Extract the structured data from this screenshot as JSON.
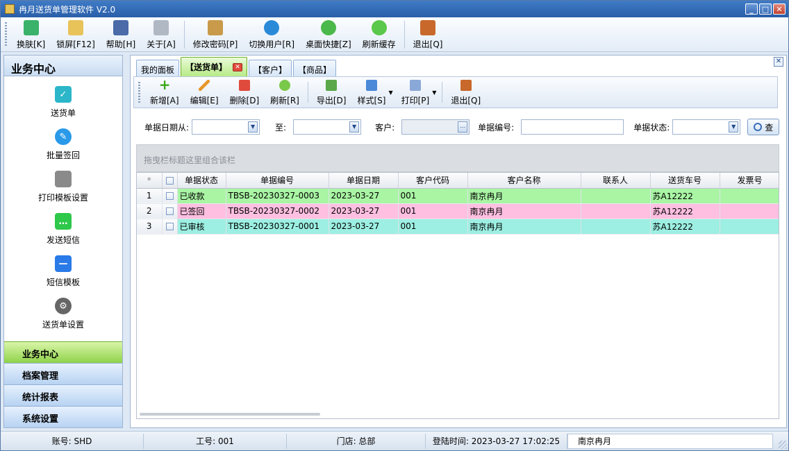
{
  "window": {
    "title": "冉月送货单管理软件 V2.0"
  },
  "main_toolbar": [
    {
      "label": "换肤[K]",
      "icon": "shirt-icon",
      "color": "#3ab26a"
    },
    {
      "label": "锁屏[F12]",
      "icon": "lock-icon",
      "color": "#e8c35a"
    },
    {
      "label": "帮助[H]",
      "icon": "help-book-icon",
      "color": "#4a6aa8"
    },
    {
      "label": "关于[A]",
      "icon": "about-icon",
      "color": "#b0b8c4"
    },
    {
      "label": "修改密码[P]",
      "icon": "key-icon",
      "color": "#c89a4a"
    },
    {
      "label": "切换用户[R]",
      "icon": "switch-user-icon",
      "color": "#2a8ad8"
    },
    {
      "label": "桌面快捷[Z]",
      "icon": "desktop-shortcut-icon",
      "color": "#4ab84a"
    },
    {
      "label": "刷新缓存",
      "icon": "refresh-cache-icon",
      "color": "#5ac84a"
    },
    {
      "label": "退出[Q]",
      "icon": "exit-door-icon",
      "color": "#c8682a"
    }
  ],
  "left_panel": {
    "title": "业务中心",
    "items": [
      {
        "label": "送货单",
        "icon": "delivery-note-icon",
        "color": "#2bb6c9"
      },
      {
        "label": "批量签回",
        "icon": "batch-sign-icon",
        "color": "#2a9ae8"
      },
      {
        "label": "打印模板设置",
        "icon": "printer-icon",
        "color": "#8a8a8a"
      },
      {
        "label": "发送短信",
        "icon": "sms-send-icon",
        "color": "#2ec84a"
      },
      {
        "label": "短信模板",
        "icon": "sms-template-icon",
        "color": "#2a7ae8"
      },
      {
        "label": "送货单设置",
        "icon": "gear-icon",
        "color": "#666666"
      }
    ],
    "groups": [
      {
        "label": "业务中心",
        "active": true
      },
      {
        "label": "档案管理",
        "active": false
      },
      {
        "label": "统计报表",
        "active": false
      },
      {
        "label": "系统设置",
        "active": false
      }
    ]
  },
  "tabs": [
    {
      "label": "我的面板"
    },
    {
      "label": "【送货单】"
    },
    {
      "label": "【客户】"
    },
    {
      "label": "【商品】"
    }
  ],
  "sub_toolbar": [
    {
      "label": "新增[A]",
      "icon": "add-icon"
    },
    {
      "label": "编辑[E]",
      "icon": "edit-pencil-icon"
    },
    {
      "label": "删除[D]",
      "icon": "delete-icon"
    },
    {
      "label": "刷新[R]",
      "icon": "refresh-icon"
    },
    {
      "label": "导出[D]",
      "icon": "export-icon"
    },
    {
      "label": "样式[S]",
      "icon": "style-icon"
    },
    {
      "label": "打印[P]",
      "icon": "print-icon"
    },
    {
      "label": "退出[Q]",
      "icon": "exit-icon"
    }
  ],
  "filter": {
    "date_from_label": "单据日期从:",
    "date_to_label": "至:",
    "customer_label": "客户:",
    "doc_no_label": "单据编号:",
    "status_label": "单据状态:",
    "query_label": "查"
  },
  "grid": {
    "group_hint": "拖曳栏标题这里组合该栏",
    "corner": "*",
    "columns": [
      "单据状态",
      "单据编号",
      "单据日期",
      "客户代码",
      "客户名称",
      "联系人",
      "送货车号",
      "发票号"
    ],
    "rows": [
      {
        "index": "1",
        "status": "已收款",
        "doc_no": "TBSB-20230327-0003",
        "date": "2023-03-27",
        "cust_code": "001",
        "cust_name": "南京冉月",
        "contact": "",
        "plate": "苏A12222",
        "invoice": ""
      },
      {
        "index": "2",
        "status": "已签回",
        "doc_no": "TBSB-20230327-0002",
        "date": "2023-03-27",
        "cust_code": "001",
        "cust_name": "南京冉月",
        "contact": "",
        "plate": "苏A12222",
        "invoice": ""
      },
      {
        "index": "3",
        "status": "已审核",
        "doc_no": "TBSB-20230327-0001",
        "date": "2023-03-27",
        "cust_code": "001",
        "cust_name": "南京冉月",
        "contact": "",
        "plate": "苏A12222",
        "invoice": ""
      }
    ]
  },
  "status_bar": {
    "account": "账号: SHD",
    "job_no": "工号: 001",
    "store": "门店: 总部",
    "login_time": "登陆时间: 2023-03-27 17:02:25",
    "shop": "南京冉月"
  },
  "colors": {
    "row_received": "#a9f5a4",
    "row_signed": "#ffbfe1",
    "row_audited": "#9cefe2"
  }
}
